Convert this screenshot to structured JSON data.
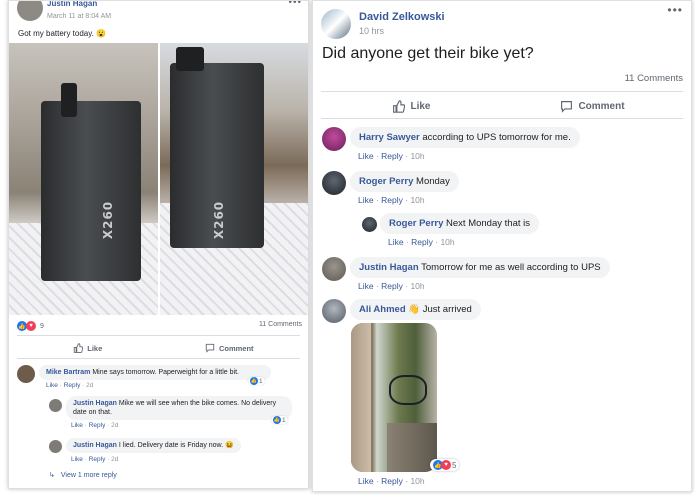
{
  "left_post": {
    "author": "Justin Hagan",
    "timestamp": "March 11 at 8:04 AM",
    "text": "Got my battery today. 😮",
    "photo_labels": [
      "X260",
      "X260"
    ],
    "reaction_count": "9",
    "comments_count": "11 Comments",
    "like_label": "Like",
    "comment_label": "Comment",
    "comments": [
      {
        "author": "Mike Bartram",
        "text": "Mine says tomorrow. Paperweight for a little bit.",
        "like": "Like",
        "reply": "Reply",
        "time": "2d",
        "likes": "1"
      },
      {
        "author": "Justin Hagan",
        "text": "Mike we will see when the bike comes. No delivery date on that.",
        "like": "Like",
        "reply": "Reply",
        "time": "2d",
        "likes": "1"
      },
      {
        "author": "Justin Hagan",
        "text": "I lied. Delivery date is Friday now. 😆",
        "like": "Like",
        "reply": "Reply",
        "time": "2d"
      }
    ],
    "more_replies": "View 1 more reply"
  },
  "right_post": {
    "author": "David Zelkowski",
    "timestamp": "10 hrs",
    "text": "Did anyone get their bike yet?",
    "comments_count": "11 Comments",
    "like_label": "Like",
    "comment_label": "Comment",
    "comments": [
      {
        "author": "Harry Sawyer",
        "text": "according to UPS tomorrow for me.",
        "like": "Like",
        "reply": "Reply",
        "time": "10h"
      },
      {
        "author": "Roger Perry",
        "text": "Monday",
        "like": "Like",
        "reply": "Reply",
        "time": "10h"
      },
      {
        "author": "Roger Perry",
        "text": "Next Monday that is",
        "like": "Like",
        "reply": "Reply",
        "time": "10h"
      },
      {
        "author": "Justin Hagan",
        "text": "Tomorrow for me as well according to UPS",
        "like": "Like",
        "reply": "Reply",
        "time": "10h"
      },
      {
        "author": "Ali Ahmed",
        "text": "👋 Just arrived",
        "like": "Like",
        "reply": "Reply",
        "time": "10h",
        "reaction_count": "5"
      }
    ]
  },
  "colors": {
    "link_blue": "#385898",
    "like_blue": "#1877f2",
    "love_red": "#f33e58",
    "meta_gray": "#90949c",
    "bubble_gray": "#f2f3f5"
  },
  "icons": [
    "like-icon",
    "love-icon",
    "thumbs-up-outline-icon",
    "comment-bubble-icon",
    "more-options-icon",
    "reply-arrow-icon"
  ]
}
